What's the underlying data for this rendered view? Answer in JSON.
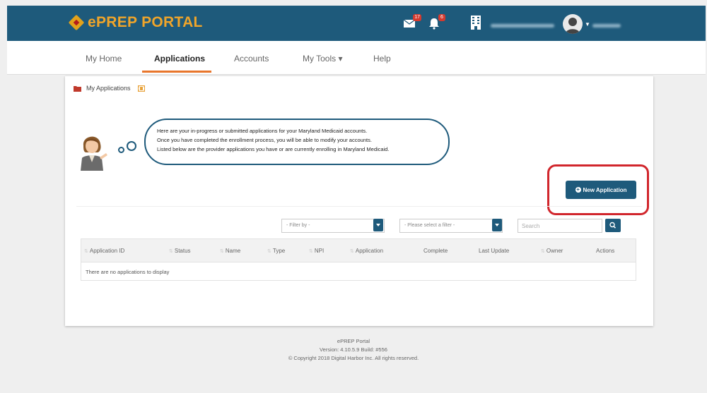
{
  "brand": {
    "logo_text": "ePREP PORTAL",
    "accent_color": "#1e5a7b",
    "logo_color": "#f0a52a",
    "highlight_color": "#d1262c"
  },
  "header": {
    "messages_badge": "17",
    "alerts_badge": "6",
    "icons": [
      "mail-icon",
      "bell-icon",
      "building-icon",
      "user-avatar"
    ]
  },
  "nav": {
    "items": [
      {
        "label": "My Home"
      },
      {
        "label": "Applications"
      },
      {
        "label": "Accounts"
      },
      {
        "label": "My Tools ▾"
      },
      {
        "label": "Help"
      }
    ]
  },
  "page": {
    "breadcrumb": "My Applications",
    "bubble_lines": [
      "Here are your in-progress or submitted applications for your Maryland Medicaid accounts.",
      "Once you have completed the enrollment process, you will be able to modify your accounts.",
      "Listed below are the provider applications you have or are currently enrolling in Maryland Medicaid."
    ],
    "new_application_label": "New Application"
  },
  "filters": {
    "filter_by_placeholder": "- Filter by -",
    "select_filter_placeholder": "- Please select a filter -",
    "search_placeholder": "Search"
  },
  "table": {
    "columns": [
      "Application ID",
      "Status",
      "Name",
      "Type",
      "NPI",
      "Application",
      "Complete",
      "Last Update",
      "Owner",
      "Actions"
    ],
    "empty_message": "There are no applications to display"
  },
  "footer": {
    "line1": "ePREP Portal",
    "line2": "Version: 4.10.5.9 Build: #556",
    "line3": "© Copyright 2018 Digital Harbor Inc. All rights reserved."
  }
}
